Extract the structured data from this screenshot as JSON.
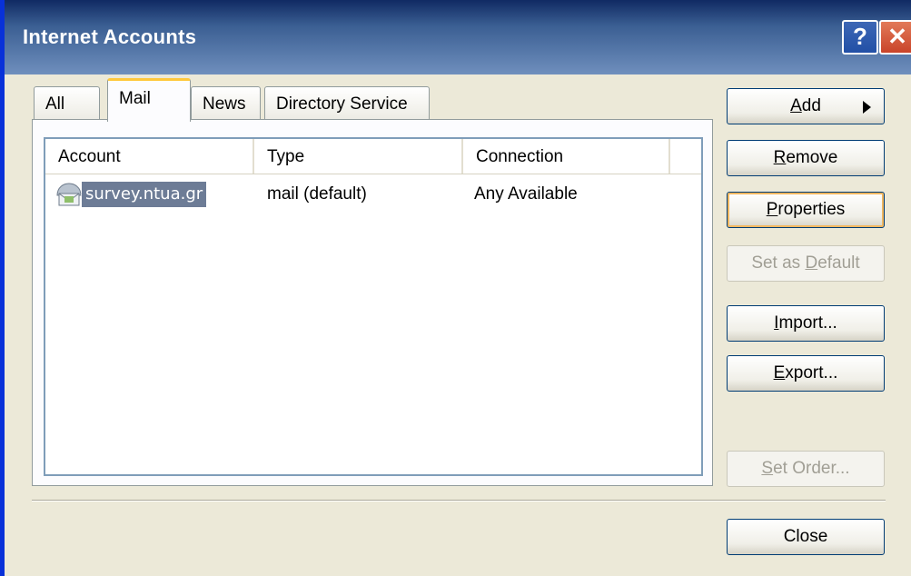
{
  "window": {
    "title": "Internet Accounts",
    "help_glyph": "?",
    "close_glyph": "✕"
  },
  "tabs": [
    {
      "label": "All",
      "active": false
    },
    {
      "label": "Mail",
      "active": true
    },
    {
      "label": "News",
      "active": false
    },
    {
      "label": "Directory Service",
      "active": false
    }
  ],
  "list": {
    "columns": [
      "Account",
      "Type",
      "Connection"
    ],
    "rows": [
      {
        "account": "survey.ntua.gr",
        "type": "mail (default)",
        "connection": "Any Available",
        "icon": "mail-account-icon",
        "selected": true
      }
    ]
  },
  "buttons": {
    "add": {
      "pre": "",
      "accel": "A",
      "post": "dd"
    },
    "remove": {
      "pre": "",
      "accel": "R",
      "post": "emove"
    },
    "properties": {
      "pre": "",
      "accel": "P",
      "post": "roperties"
    },
    "set_default": {
      "pre": "Set as ",
      "accel": "D",
      "post": "efault"
    },
    "import": {
      "pre": "",
      "accel": "I",
      "post": "mport..."
    },
    "export": {
      "pre": "",
      "accel": "E",
      "post": "xport..."
    },
    "set_order": {
      "pre": "",
      "accel": "S",
      "post": "et Order..."
    },
    "close": {
      "label": "Close"
    }
  },
  "colors": {
    "selection": "#6d7c96",
    "default_button_ring": "#f0b760",
    "active_tab_accent": "#ffc83c"
  }
}
